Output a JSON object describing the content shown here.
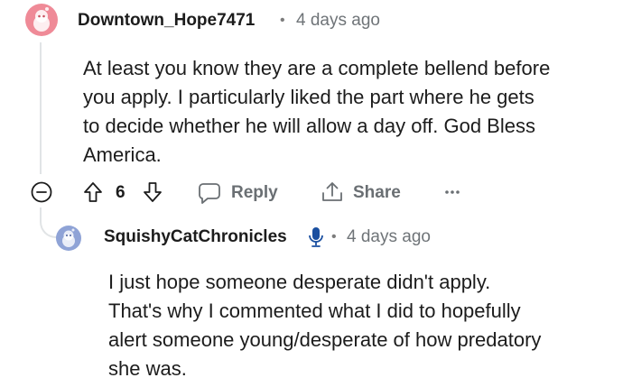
{
  "comment": {
    "author": "Downtown_Hope7471",
    "separator": "•",
    "time": "4 days ago",
    "body": "At least you know they are a complete bellend before you apply. I particularly liked the part where he gets to decide whether he will allow a day off. God Bless America.",
    "body_lines": [
      "At least you know they are a complete bellend before",
      "you apply. I particularly liked the part where he gets",
      "to decide whether he will allow a day off. God Bless",
      "America."
    ],
    "score": "6",
    "actions": {
      "reply": "Reply",
      "share": "Share"
    }
  },
  "reply": {
    "author": "SquishyCatChronicles",
    "separator": "•",
    "time": "4 days ago",
    "body_lines": [
      "I just hope someone desperate didn't apply.",
      "That's why I commented what I did to hopefully",
      "alert someone young/desperate of how predatory",
      "she was."
    ]
  },
  "icons": {
    "collapse": "minus-circle-icon",
    "upvote": "arrow-up-icon",
    "downvote": "arrow-down-icon",
    "reply": "speech-bubble-icon",
    "share": "share-upload-icon",
    "more": "ellipsis-icon",
    "badge": "microphone-icon"
  },
  "colors": {
    "avatar_1": "#ef8a97",
    "avatar_2": "#8fa3d6",
    "badge": "#1a4fa0",
    "muted": "#6a6f73"
  }
}
